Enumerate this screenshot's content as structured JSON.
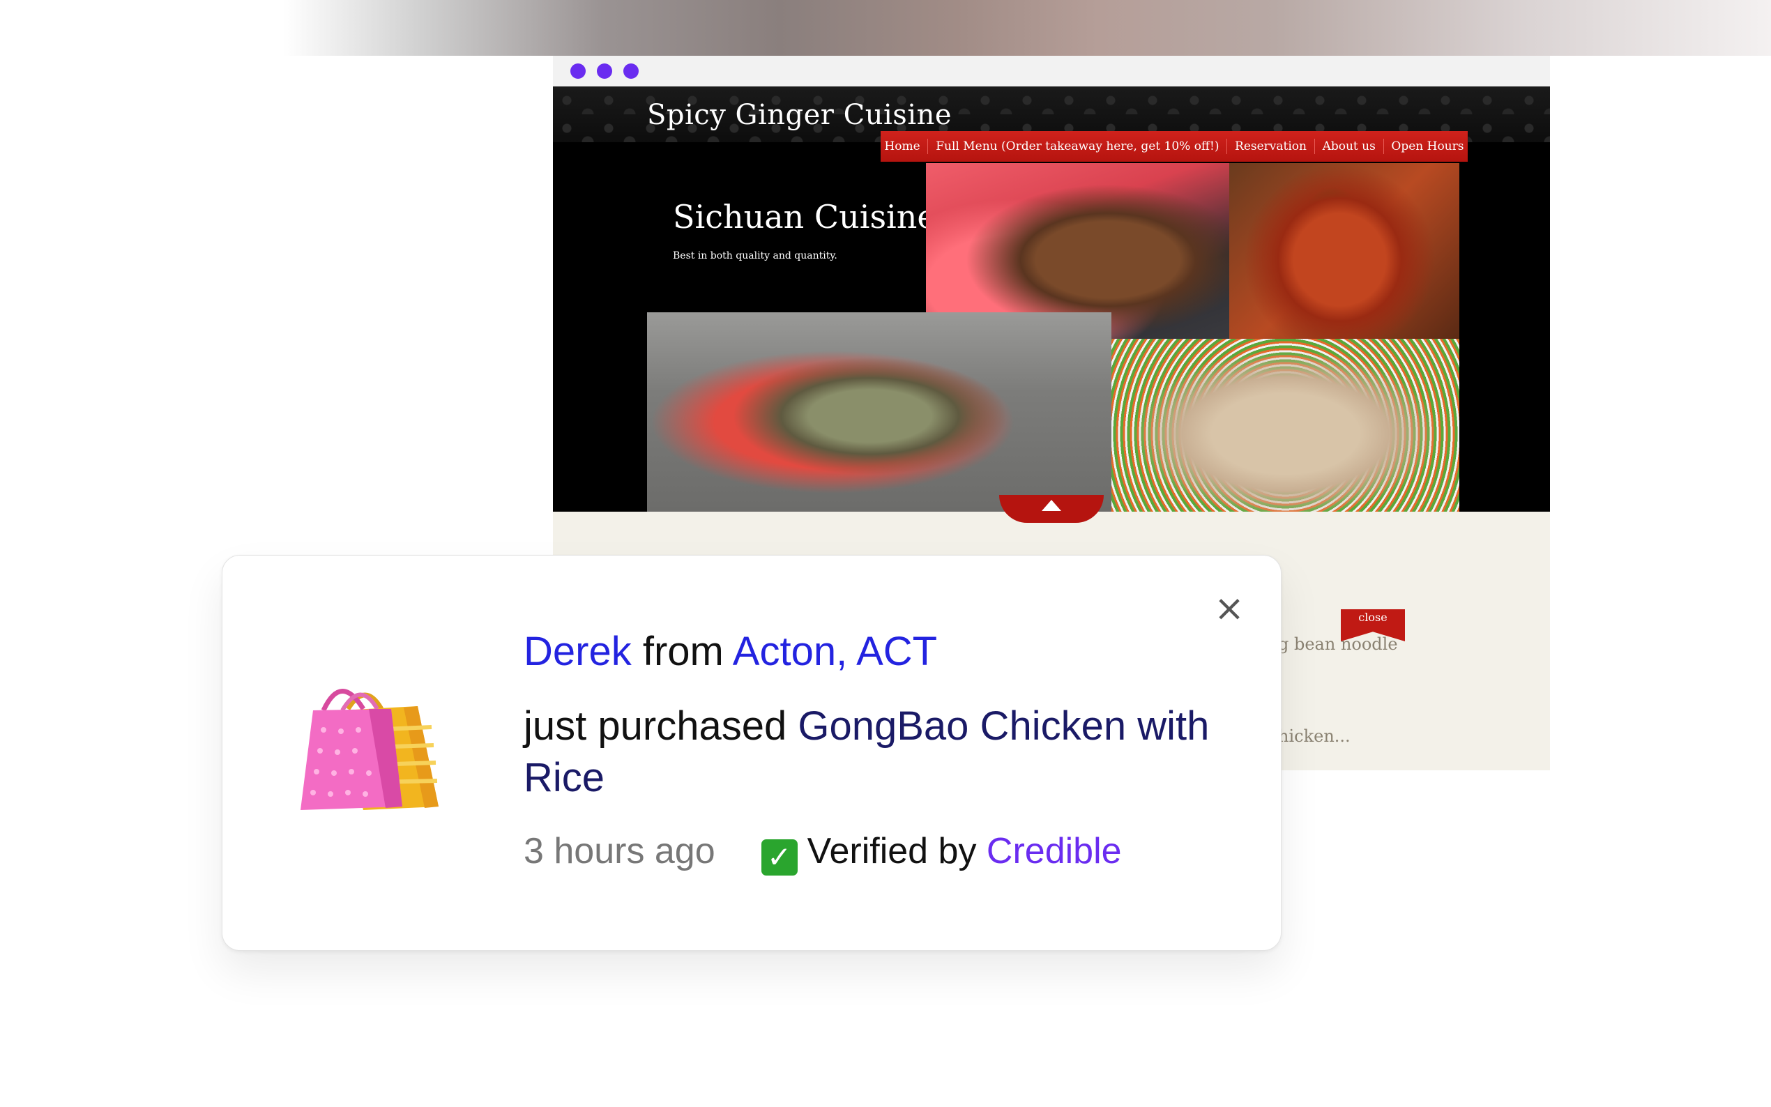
{
  "site": {
    "title": "Spicy Ginger Cuisine",
    "nav": [
      "Home",
      "Full Menu (Order takeaway here, get 10% off!)",
      "Reservation",
      "About us",
      "Open Hours"
    ],
    "hero_title": "Sichuan Cuisine",
    "hero_subtitle": "Best in both quality and quantity.",
    "ribbon_label": "close",
    "partial_text_1": "g bean noodle",
    "partial_text_2": "hicken..."
  },
  "notification": {
    "name": "Derek",
    "from_word": "from",
    "location": "Acton, ACT",
    "purchased_prefix": "just purchased",
    "product": "GongBao Chicken with Rice",
    "time_ago": "3 hours ago",
    "verified_prefix": "Verified by",
    "verified_brand": "Credible",
    "close_symbol": "×",
    "check_symbol": "✓"
  },
  "colors": {
    "accent_purple": "#6a2cf0",
    "link_blue": "#2323e0",
    "product_navy": "#1a1a66",
    "nav_red": "#c01a14",
    "check_green": "#2aa52e"
  },
  "icons": {
    "bag": "shopping-bags-icon",
    "check": "check-box-icon",
    "close": "close-icon"
  }
}
